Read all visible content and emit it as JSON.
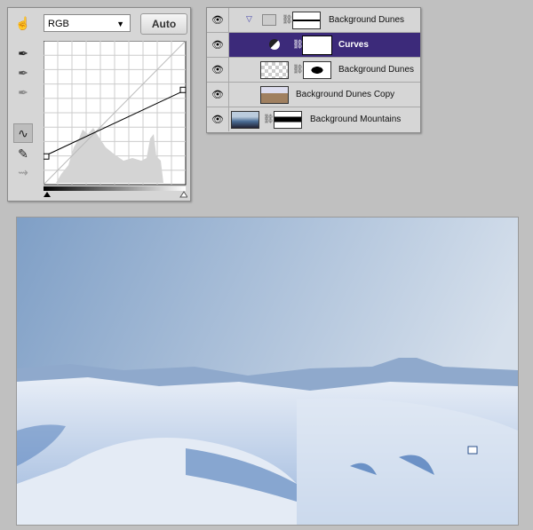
{
  "curves_panel": {
    "channel": "RGB",
    "auto_label": "Auto",
    "tools": [
      "on-image-adjust-icon",
      "black-eyedropper-icon",
      "gray-eyedropper-icon",
      "white-eyedropper-icon",
      "curve-point-tool-icon",
      "pencil-tool-icon",
      "smooth-curve-icon"
    ],
    "curve_points": [
      [
        0,
        50
      ],
      [
        255,
        168
      ]
    ],
    "input_range": [
      0,
      255
    ],
    "output_range": [
      0,
      255
    ]
  },
  "layers_panel": {
    "layers": [
      {
        "name": "Background Dunes",
        "type": "group",
        "visible": true,
        "selected": false
      },
      {
        "name": "Curves",
        "type": "adjustment",
        "visible": true,
        "selected": true
      },
      {
        "name": "Background Dunes",
        "type": "smart-object",
        "visible": true,
        "selected": false
      },
      {
        "name": "Background Dunes Copy",
        "type": "smart-object",
        "visible": true,
        "selected": false
      },
      {
        "name": "Background Mountains",
        "type": "layer",
        "visible": true,
        "selected": false
      }
    ]
  },
  "colors": {
    "selection": "#3c2a7a",
    "sky_top": "#7f9fc6",
    "sky_light": "#d6e0ec",
    "snow": "#e6ecf5",
    "shadow": "#3f6fb3"
  }
}
